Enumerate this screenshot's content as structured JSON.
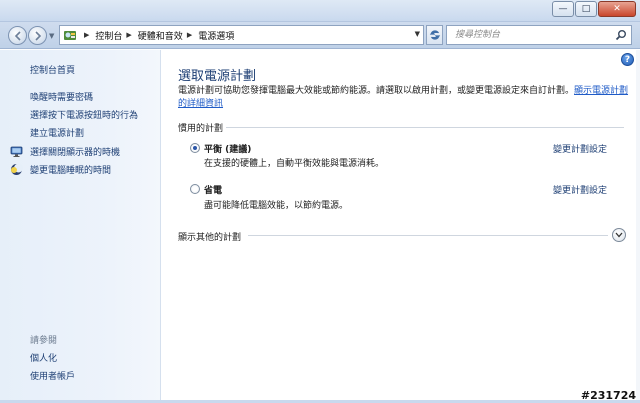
{
  "titlebar": {
    "minimize_glyph": "—",
    "maximize_glyph": "□",
    "close_glyph": "✕"
  },
  "address": {
    "breadcrumbs": [
      "控制台",
      "硬體和音效",
      "電源選項"
    ],
    "separator": "▶",
    "search_placeholder": "搜尋控制台"
  },
  "sidebar": {
    "home": "控制台首頁",
    "items": [
      {
        "label": "喚醒時需要密碼",
        "icon": ""
      },
      {
        "label": "選擇按下電源按鈕時的行為",
        "icon": ""
      },
      {
        "label": "建立電源計劃",
        "icon": ""
      },
      {
        "label": "選擇關閉顯示器的時機",
        "icon": "monitor-icon"
      },
      {
        "label": "變更電腦睡眠的時間",
        "icon": "moon-icon"
      }
    ],
    "see_also_title": "請參閱",
    "see_also": [
      "個人化",
      "使用者帳戶"
    ]
  },
  "main": {
    "heading": "選取電源計劃",
    "description": "電源計劃可協助您發揮電腦最大效能或節約能源。請選取以啟用計劃，或變更電源設定來自訂計劃。",
    "description_link": "顯示電源計劃的詳細資訊",
    "group_title": "慣用的計劃",
    "plans": [
      {
        "name": "平衡 (建議)",
        "desc": "在支援的硬體上，自動平衡效能與電源消耗。",
        "link": "變更計劃設定",
        "checked": true
      },
      {
        "name": "省電",
        "desc": "盡可能降低電腦效能，以節約電源。",
        "link": "變更計劃設定",
        "checked": false
      }
    ],
    "more_plans": "顯示其他的計劃"
  },
  "watermark": "#231724",
  "colors": {
    "link": "#1e3f74",
    "accent": "#1f5bc7",
    "sidebar_bg": "#e6eff9"
  }
}
